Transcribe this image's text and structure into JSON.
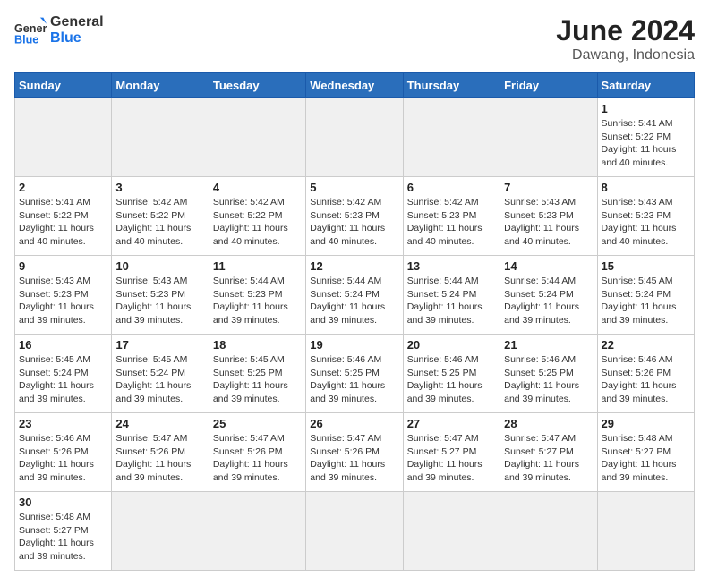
{
  "header": {
    "logo_general": "General",
    "logo_blue": "Blue",
    "month_year": "June 2024",
    "location": "Dawang, Indonesia"
  },
  "days_of_week": [
    "Sunday",
    "Monday",
    "Tuesday",
    "Wednesday",
    "Thursday",
    "Friday",
    "Saturday"
  ],
  "weeks": [
    {
      "days": [
        {
          "num": "",
          "info": "",
          "empty": true
        },
        {
          "num": "",
          "info": "",
          "empty": true
        },
        {
          "num": "",
          "info": "",
          "empty": true
        },
        {
          "num": "",
          "info": "",
          "empty": true
        },
        {
          "num": "",
          "info": "",
          "empty": true
        },
        {
          "num": "",
          "info": "",
          "empty": true
        },
        {
          "num": "1",
          "info": "Sunrise: 5:41 AM\nSunset: 5:22 PM\nDaylight: 11 hours and 40 minutes.",
          "empty": false
        }
      ]
    },
    {
      "days": [
        {
          "num": "2",
          "info": "Sunrise: 5:41 AM\nSunset: 5:22 PM\nDaylight: 11 hours and 40 minutes.",
          "empty": false
        },
        {
          "num": "3",
          "info": "Sunrise: 5:42 AM\nSunset: 5:22 PM\nDaylight: 11 hours and 40 minutes.",
          "empty": false
        },
        {
          "num": "4",
          "info": "Sunrise: 5:42 AM\nSunset: 5:22 PM\nDaylight: 11 hours and 40 minutes.",
          "empty": false
        },
        {
          "num": "5",
          "info": "Sunrise: 5:42 AM\nSunset: 5:23 PM\nDaylight: 11 hours and 40 minutes.",
          "empty": false
        },
        {
          "num": "6",
          "info": "Sunrise: 5:42 AM\nSunset: 5:23 PM\nDaylight: 11 hours and 40 minutes.",
          "empty": false
        },
        {
          "num": "7",
          "info": "Sunrise: 5:43 AM\nSunset: 5:23 PM\nDaylight: 11 hours and 40 minutes.",
          "empty": false
        },
        {
          "num": "8",
          "info": "Sunrise: 5:43 AM\nSunset: 5:23 PM\nDaylight: 11 hours and 40 minutes.",
          "empty": false
        }
      ]
    },
    {
      "days": [
        {
          "num": "9",
          "info": "Sunrise: 5:43 AM\nSunset: 5:23 PM\nDaylight: 11 hours and 39 minutes.",
          "empty": false
        },
        {
          "num": "10",
          "info": "Sunrise: 5:43 AM\nSunset: 5:23 PM\nDaylight: 11 hours and 39 minutes.",
          "empty": false
        },
        {
          "num": "11",
          "info": "Sunrise: 5:44 AM\nSunset: 5:23 PM\nDaylight: 11 hours and 39 minutes.",
          "empty": false
        },
        {
          "num": "12",
          "info": "Sunrise: 5:44 AM\nSunset: 5:24 PM\nDaylight: 11 hours and 39 minutes.",
          "empty": false
        },
        {
          "num": "13",
          "info": "Sunrise: 5:44 AM\nSunset: 5:24 PM\nDaylight: 11 hours and 39 minutes.",
          "empty": false
        },
        {
          "num": "14",
          "info": "Sunrise: 5:44 AM\nSunset: 5:24 PM\nDaylight: 11 hours and 39 minutes.",
          "empty": false
        },
        {
          "num": "15",
          "info": "Sunrise: 5:45 AM\nSunset: 5:24 PM\nDaylight: 11 hours and 39 minutes.",
          "empty": false
        }
      ]
    },
    {
      "days": [
        {
          "num": "16",
          "info": "Sunrise: 5:45 AM\nSunset: 5:24 PM\nDaylight: 11 hours and 39 minutes.",
          "empty": false
        },
        {
          "num": "17",
          "info": "Sunrise: 5:45 AM\nSunset: 5:24 PM\nDaylight: 11 hours and 39 minutes.",
          "empty": false
        },
        {
          "num": "18",
          "info": "Sunrise: 5:45 AM\nSunset: 5:25 PM\nDaylight: 11 hours and 39 minutes.",
          "empty": false
        },
        {
          "num": "19",
          "info": "Sunrise: 5:46 AM\nSunset: 5:25 PM\nDaylight: 11 hours and 39 minutes.",
          "empty": false
        },
        {
          "num": "20",
          "info": "Sunrise: 5:46 AM\nSunset: 5:25 PM\nDaylight: 11 hours and 39 minutes.",
          "empty": false
        },
        {
          "num": "21",
          "info": "Sunrise: 5:46 AM\nSunset: 5:25 PM\nDaylight: 11 hours and 39 minutes.",
          "empty": false
        },
        {
          "num": "22",
          "info": "Sunrise: 5:46 AM\nSunset: 5:26 PM\nDaylight: 11 hours and 39 minutes.",
          "empty": false
        }
      ]
    },
    {
      "days": [
        {
          "num": "23",
          "info": "Sunrise: 5:46 AM\nSunset: 5:26 PM\nDaylight: 11 hours and 39 minutes.",
          "empty": false
        },
        {
          "num": "24",
          "info": "Sunrise: 5:47 AM\nSunset: 5:26 PM\nDaylight: 11 hours and 39 minutes.",
          "empty": false
        },
        {
          "num": "25",
          "info": "Sunrise: 5:47 AM\nSunset: 5:26 PM\nDaylight: 11 hours and 39 minutes.",
          "empty": false
        },
        {
          "num": "26",
          "info": "Sunrise: 5:47 AM\nSunset: 5:26 PM\nDaylight: 11 hours and 39 minutes.",
          "empty": false
        },
        {
          "num": "27",
          "info": "Sunrise: 5:47 AM\nSunset: 5:27 PM\nDaylight: 11 hours and 39 minutes.",
          "empty": false
        },
        {
          "num": "28",
          "info": "Sunrise: 5:47 AM\nSunset: 5:27 PM\nDaylight: 11 hours and 39 minutes.",
          "empty": false
        },
        {
          "num": "29",
          "info": "Sunrise: 5:48 AM\nSunset: 5:27 PM\nDaylight: 11 hours and 39 minutes.",
          "empty": false
        }
      ]
    },
    {
      "days": [
        {
          "num": "30",
          "info": "Sunrise: 5:48 AM\nSunset: 5:27 PM\nDaylight: 11 hours and 39 minutes.",
          "empty": false
        },
        {
          "num": "",
          "info": "",
          "empty": true
        },
        {
          "num": "",
          "info": "",
          "empty": true
        },
        {
          "num": "",
          "info": "",
          "empty": true
        },
        {
          "num": "",
          "info": "",
          "empty": true
        },
        {
          "num": "",
          "info": "",
          "empty": true
        },
        {
          "num": "",
          "info": "",
          "empty": true
        }
      ]
    }
  ]
}
